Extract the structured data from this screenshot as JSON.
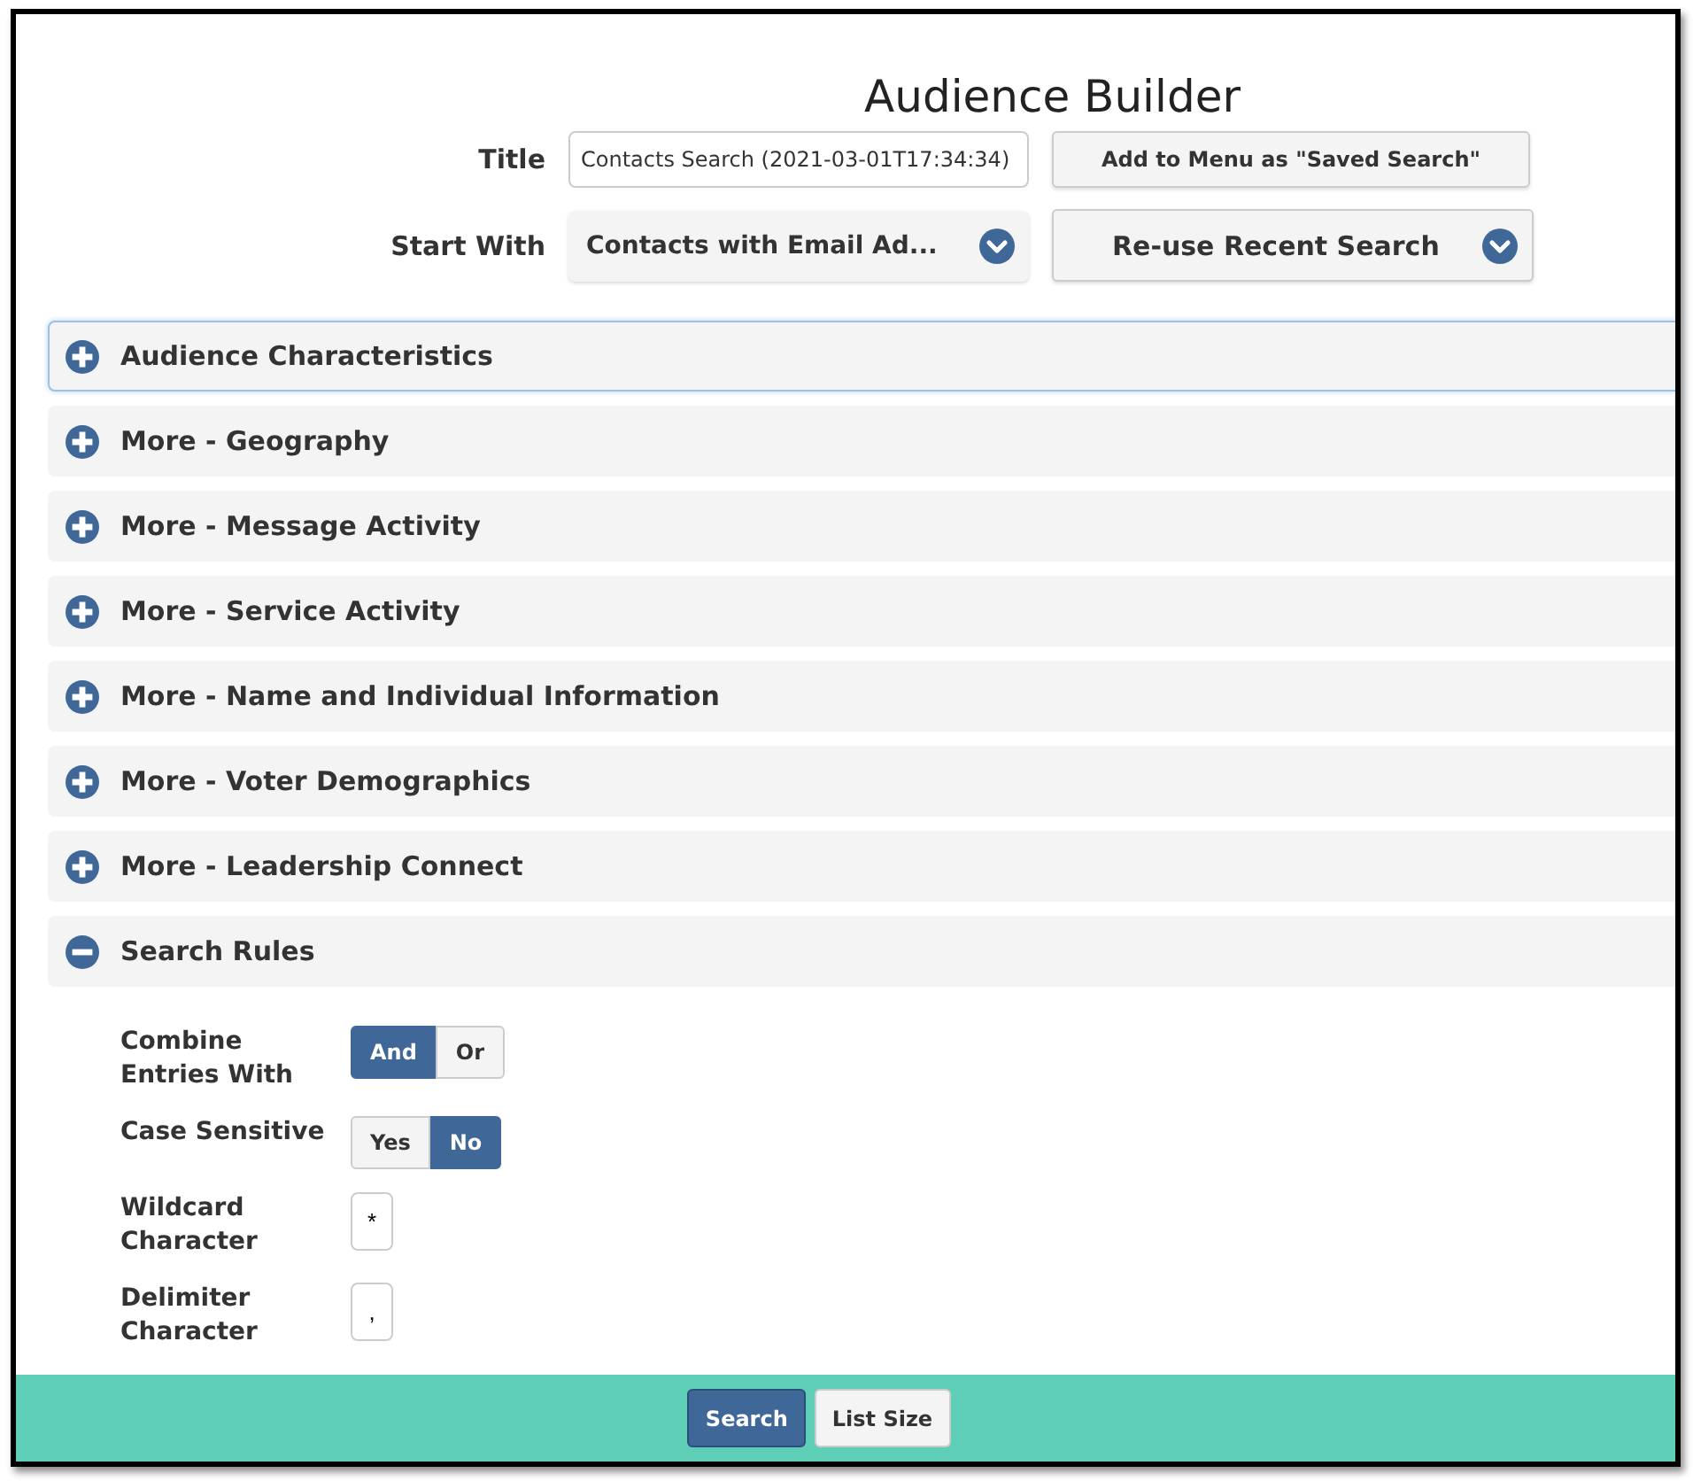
{
  "page": {
    "title": "Audience Builder"
  },
  "form": [
    {
      "kind": "input",
      "label": "Title",
      "value": "Contacts Search (2021-03-01T17:34:34)",
      "action": "Add to Menu as \"Saved Search\""
    },
    {
      "kind": "select",
      "label": "Start With",
      "value": "Contacts with Email Ad...",
      "action": "Re-use Recent Search"
    }
  ],
  "sections": [
    {
      "label": "Audience Characteristics",
      "expanded": false,
      "focused": true
    },
    {
      "label": "More - Geography",
      "expanded": false,
      "focused": false
    },
    {
      "label": "More - Message Activity",
      "expanded": false,
      "focused": false
    },
    {
      "label": "More - Service Activity",
      "expanded": false,
      "focused": false
    },
    {
      "label": "More - Name and Individual Information",
      "expanded": false,
      "focused": false
    },
    {
      "label": "More - Voter Demographics",
      "expanded": false,
      "focused": false
    },
    {
      "label": "More - Leadership Connect",
      "expanded": false,
      "focused": false
    },
    {
      "label": "Search Rules",
      "expanded": true,
      "focused": false
    }
  ],
  "search_rules": [
    {
      "kind": "toggle",
      "label": "Combine Entries With",
      "options": [
        {
          "label": "And",
          "selected": true
        },
        {
          "label": "Or",
          "selected": false
        }
      ]
    },
    {
      "kind": "toggle",
      "label": "Case Sensitive",
      "options": [
        {
          "label": "Yes",
          "selected": false
        },
        {
          "label": "No",
          "selected": true
        }
      ]
    },
    {
      "kind": "input",
      "label": "Wildcard Character",
      "value": "*"
    },
    {
      "kind": "input",
      "label": "Delimiter Character",
      "value": ","
    }
  ],
  "footer": {
    "buttons": [
      {
        "label": "Search",
        "primary": true
      },
      {
        "label": "List Size",
        "primary": false
      }
    ]
  }
}
